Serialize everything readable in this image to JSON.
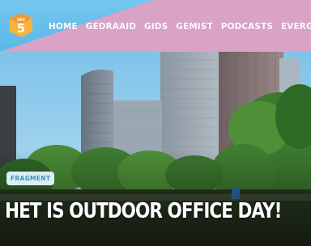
{
  "header": {
    "logo": {
      "icon": "npo3-logo-icon",
      "text": "5",
      "colors": {
        "badge": "#f6b33d",
        "top": "#f08a2c"
      }
    },
    "nav": [
      {
        "label": "HOME"
      },
      {
        "label": "GEDRAAID"
      },
      {
        "label": "GIDS"
      },
      {
        "label": "GEMIST"
      },
      {
        "label": "PODCASTS"
      },
      {
        "label": "EVERGREEN"
      }
    ],
    "colors": {
      "blue": "#6bc1ec",
      "pink": "#d9a3c6"
    }
  },
  "hero": {
    "badge": "FRAGMENT",
    "title": "HET IS OUTDOOR OFFICE DAY!"
  }
}
